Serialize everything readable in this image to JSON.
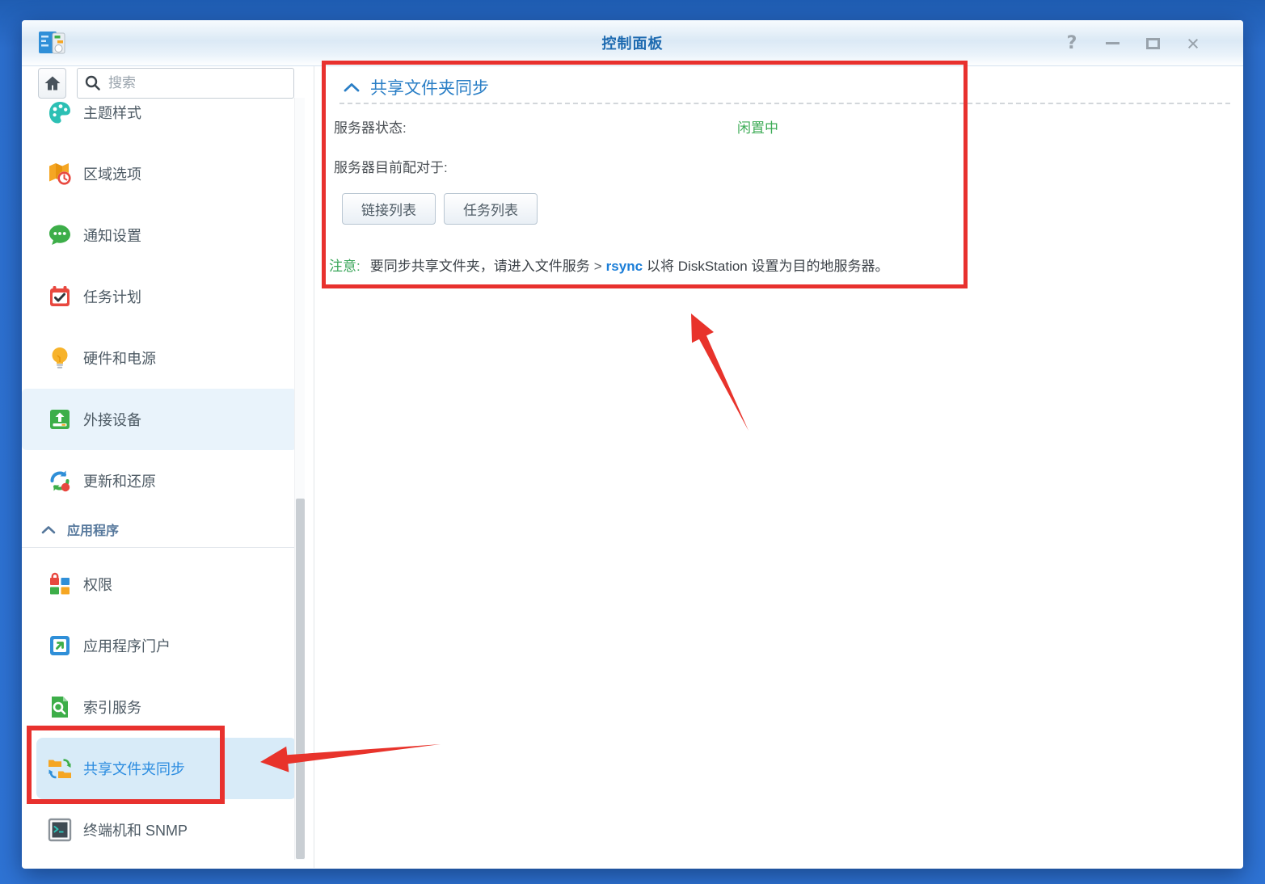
{
  "window": {
    "title": "控制面板",
    "controls": {
      "help": "?",
      "close": "×"
    }
  },
  "sidebar": {
    "search_placeholder": "搜索",
    "section_label": "应用程序",
    "items": [
      {
        "label": "主题样式",
        "icon": "palette-icon"
      },
      {
        "label": "区域选项",
        "icon": "map-clock-icon"
      },
      {
        "label": "通知设置",
        "icon": "chat-bubble-icon"
      },
      {
        "label": "任务计划",
        "icon": "calendar-check-icon"
      },
      {
        "label": "硬件和电源",
        "icon": "lightbulb-icon"
      },
      {
        "label": "外接设备",
        "icon": "external-device-icon",
        "highlighted": true
      },
      {
        "label": "更新和还原",
        "icon": "sync-arrows-icon"
      },
      {
        "label": "权限",
        "icon": "grid-lock-icon"
      },
      {
        "label": "应用程序门户",
        "icon": "portal-arrow-icon"
      },
      {
        "label": "索引服务",
        "icon": "doc-search-icon"
      },
      {
        "label": "共享文件夹同步",
        "icon": "folder-sync-icon",
        "selected": true
      },
      {
        "label": "终端机和 SNMP",
        "icon": "terminal-icon"
      }
    ]
  },
  "main": {
    "section_title": "共享文件夹同步",
    "server_status_label": "服务器状态:",
    "server_status_value": "闲置中",
    "paired_label": "服务器目前配对于:",
    "buttons": [
      "链接列表",
      "任务列表"
    ],
    "note": {
      "prefix": "注意:",
      "text_before": "要同步共享文件夹，请进入文件服务",
      "gt": ">",
      "link": "rsync",
      "text_after": "以将 DiskStation 设置为目的地服务器。"
    }
  },
  "colors": {
    "status_green": "#3cab55",
    "note_green": "#3aa65a",
    "link_blue": "#1b7ed8",
    "title_blue": "#1d6ab0",
    "section_blue": "#2b7fc6",
    "selected_item_blue": "#2b8ce0",
    "selected_item_bg": "#d8ebf8",
    "annotation_red": "#e8312e",
    "desktop_blue": "#2e73d4"
  }
}
